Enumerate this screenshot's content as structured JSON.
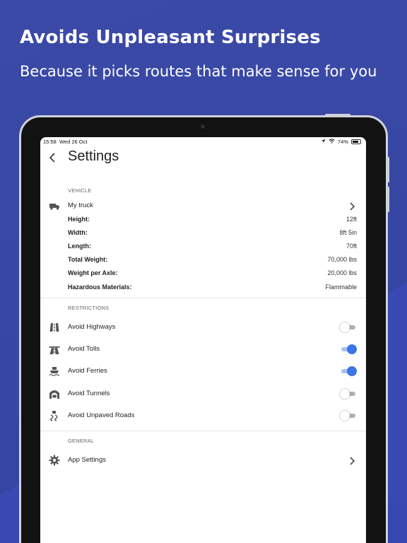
{
  "headline": "Avoids Unpleasant Surprises",
  "subline": "Because it picks routes that make sense for you",
  "colors": {
    "background": "#3746a3",
    "accent_toggle": "#3d75e8",
    "toggle_off": "#aeb0b4"
  },
  "status_bar": {
    "time": "15:58",
    "date": "Wed 26 Oct",
    "battery": "74%",
    "icons": [
      "location-arrow-icon",
      "wifi-icon",
      "battery-icon"
    ]
  },
  "nav": {
    "back_icon": "chevron-left-icon",
    "title": "Settings"
  },
  "vehicle": {
    "section_label": "VEHICLE",
    "name": "My truck",
    "icon": "truck-icon",
    "specs": [
      {
        "label": "Height:",
        "value": "12ft"
      },
      {
        "label": "Width:",
        "value": "8ft 5in"
      },
      {
        "label": "Length:",
        "value": "70ft"
      },
      {
        "label": "Total Weight:",
        "value": "70,000 lbs"
      },
      {
        "label": "Weight per Axle:",
        "value": "20,000 lbs"
      },
      {
        "label": "Hazardous Materials:",
        "value": "Flammable"
      }
    ]
  },
  "restrictions": {
    "section_label": "RESTRICTIONS",
    "items": [
      {
        "label": "Avoid Highways",
        "icon": "highway-icon",
        "enabled": false
      },
      {
        "label": "Avoid Tolls",
        "icon": "toll-road-icon",
        "enabled": true
      },
      {
        "label": "Avoid Ferries",
        "icon": "ferry-icon",
        "enabled": true
      },
      {
        "label": "Avoid Tunnels",
        "icon": "tunnel-icon",
        "enabled": false
      },
      {
        "label": "Avoid Unpaved Roads",
        "icon": "unpaved-road-icon",
        "enabled": false
      }
    ]
  },
  "general": {
    "section_label": "GENERAL",
    "items": [
      {
        "label": "App Settings",
        "icon": "gear-icon"
      }
    ]
  }
}
